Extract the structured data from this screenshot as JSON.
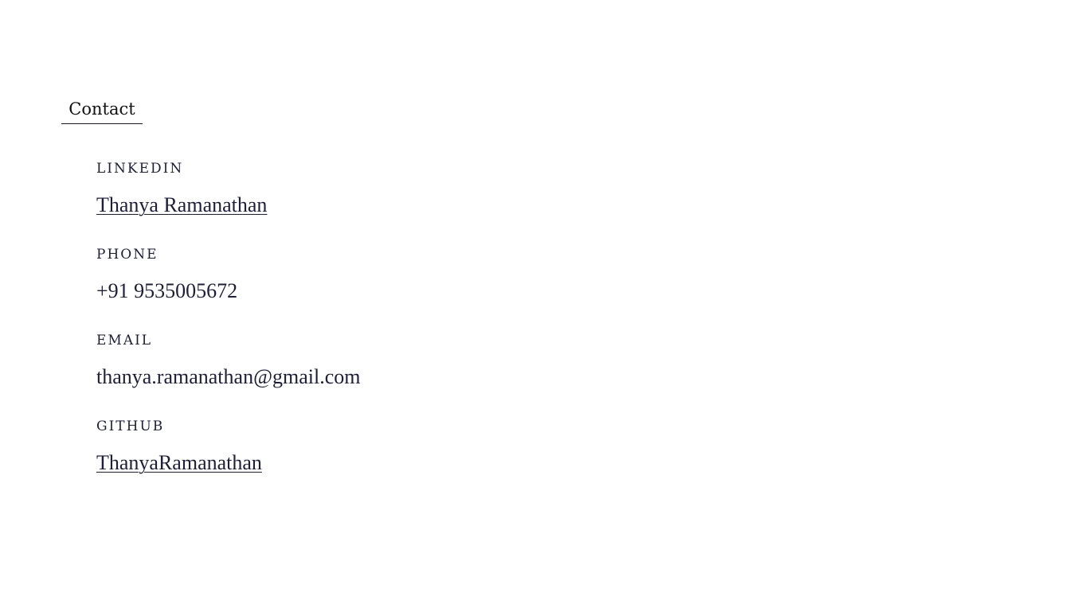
{
  "section": {
    "title": "Contact"
  },
  "contacts": [
    {
      "label": "LINKEDIN",
      "value": "Thanya Ramanathan"
    },
    {
      "label": "PHONE",
      "value": "+91 9535005672"
    },
    {
      "label": "EMAIL",
      "value": "thanya.ramanathan@gmail.com"
    },
    {
      "label": "GITHUB",
      "value": "ThanyaRamanathan"
    }
  ],
  "colors": {
    "text": "#1e1e3c",
    "background": "#ffffff"
  }
}
